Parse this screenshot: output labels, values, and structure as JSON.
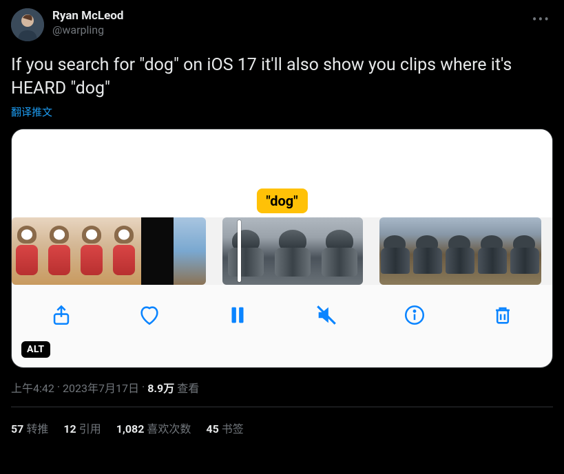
{
  "author": {
    "display_name": "Ryan McLeod",
    "handle": "@warpling"
  },
  "tweet_text": "If you search for \"dog\" on iOS 17 it'll also show you clips where it's HEARD \"dog\"",
  "translate_label": "翻译推文",
  "media": {
    "keyword_tag": "\"dog\"",
    "alt_badge": "ALT"
  },
  "timestamp": {
    "time": "上午4:42",
    "sep": " · ",
    "date": "2023年7月17日",
    "views_count": "8.9万",
    "views_label": "查看"
  },
  "stats": {
    "retweets_count": "57",
    "retweets_label": "转推",
    "quotes_count": "12",
    "quotes_label": "引用",
    "likes_count": "1,082",
    "likes_label": "喜欢次数",
    "bookmarks_count": "45",
    "bookmarks_label": "书签"
  }
}
